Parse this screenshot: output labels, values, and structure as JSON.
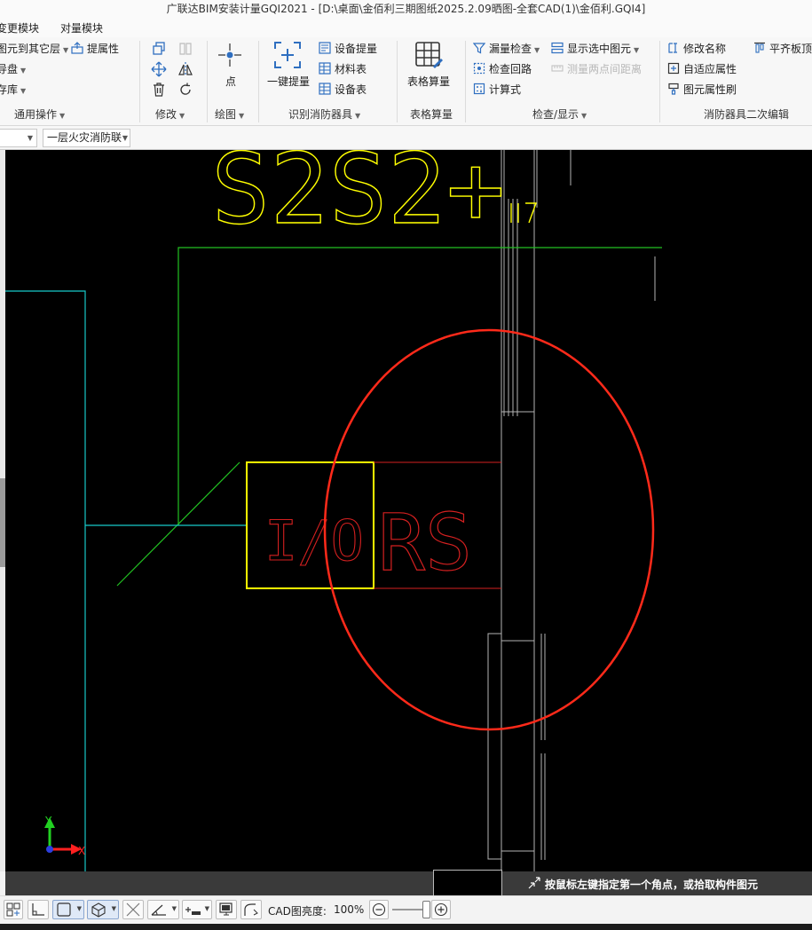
{
  "window": {
    "title": "广联达BIM安装计量GQI2021 - [D:\\桌面\\金佰利三期图纸2025.2.09晒图-全套CAD(1)\\金佰利.GQI4]"
  },
  "menu": {
    "items": [
      "变更模块",
      "对量模块"
    ]
  },
  "ribbon": {
    "common_ops": {
      "items": [
        "图元到其它层",
        "提属性",
        "导盘",
        "存库"
      ],
      "label": "通用操作"
    },
    "modify": {
      "label": "修改"
    },
    "draw": {
      "point_label": "点",
      "label": "绘图"
    },
    "recognize": {
      "one_click_label": "一键提量",
      "equipment_extract": "设备提量",
      "material_table": "材料表",
      "equipment_table": "设备表",
      "label": "识别消防器具"
    },
    "table_calc": {
      "button_label": "表格算量",
      "label": "表格算量"
    },
    "check_display": {
      "missing_check": "漏量检查",
      "show_selected": "显示选中图元",
      "check_loop": "检查回路",
      "measure_distance": "测量两点间距离",
      "formula": "计算式",
      "label": "检查/显示"
    },
    "secondary_edit": {
      "rename": "修改名称",
      "align_board": "平齐板顶",
      "adaptive_attr": "自适应属性",
      "attr_brush": "图元属性刷",
      "label": "消防器具二次编辑"
    }
  },
  "selectors": {
    "first_value": "",
    "floor_value": "一层火灾消防联"
  },
  "canvas": {
    "top_text": "S2S2+",
    "block_left_text": "I/O",
    "block_right_text": "RS",
    "axis_x": "X",
    "axis_y": "Y",
    "colors": {
      "background": "#000000",
      "yellow": "#ffff00",
      "green": "#22c022",
      "cyan": "#17c9c9",
      "red_text": "#d42020",
      "annotation_circle": "#ff2a1a",
      "grey_lines": "#b8b8b8"
    }
  },
  "command_line": {
    "prompt": "按鼠标左键指定第一个角点，或拾取构件图元"
  },
  "status_bar": {
    "cad_brightness_label": "CAD图亮度:",
    "cad_brightness_value": "100%"
  }
}
